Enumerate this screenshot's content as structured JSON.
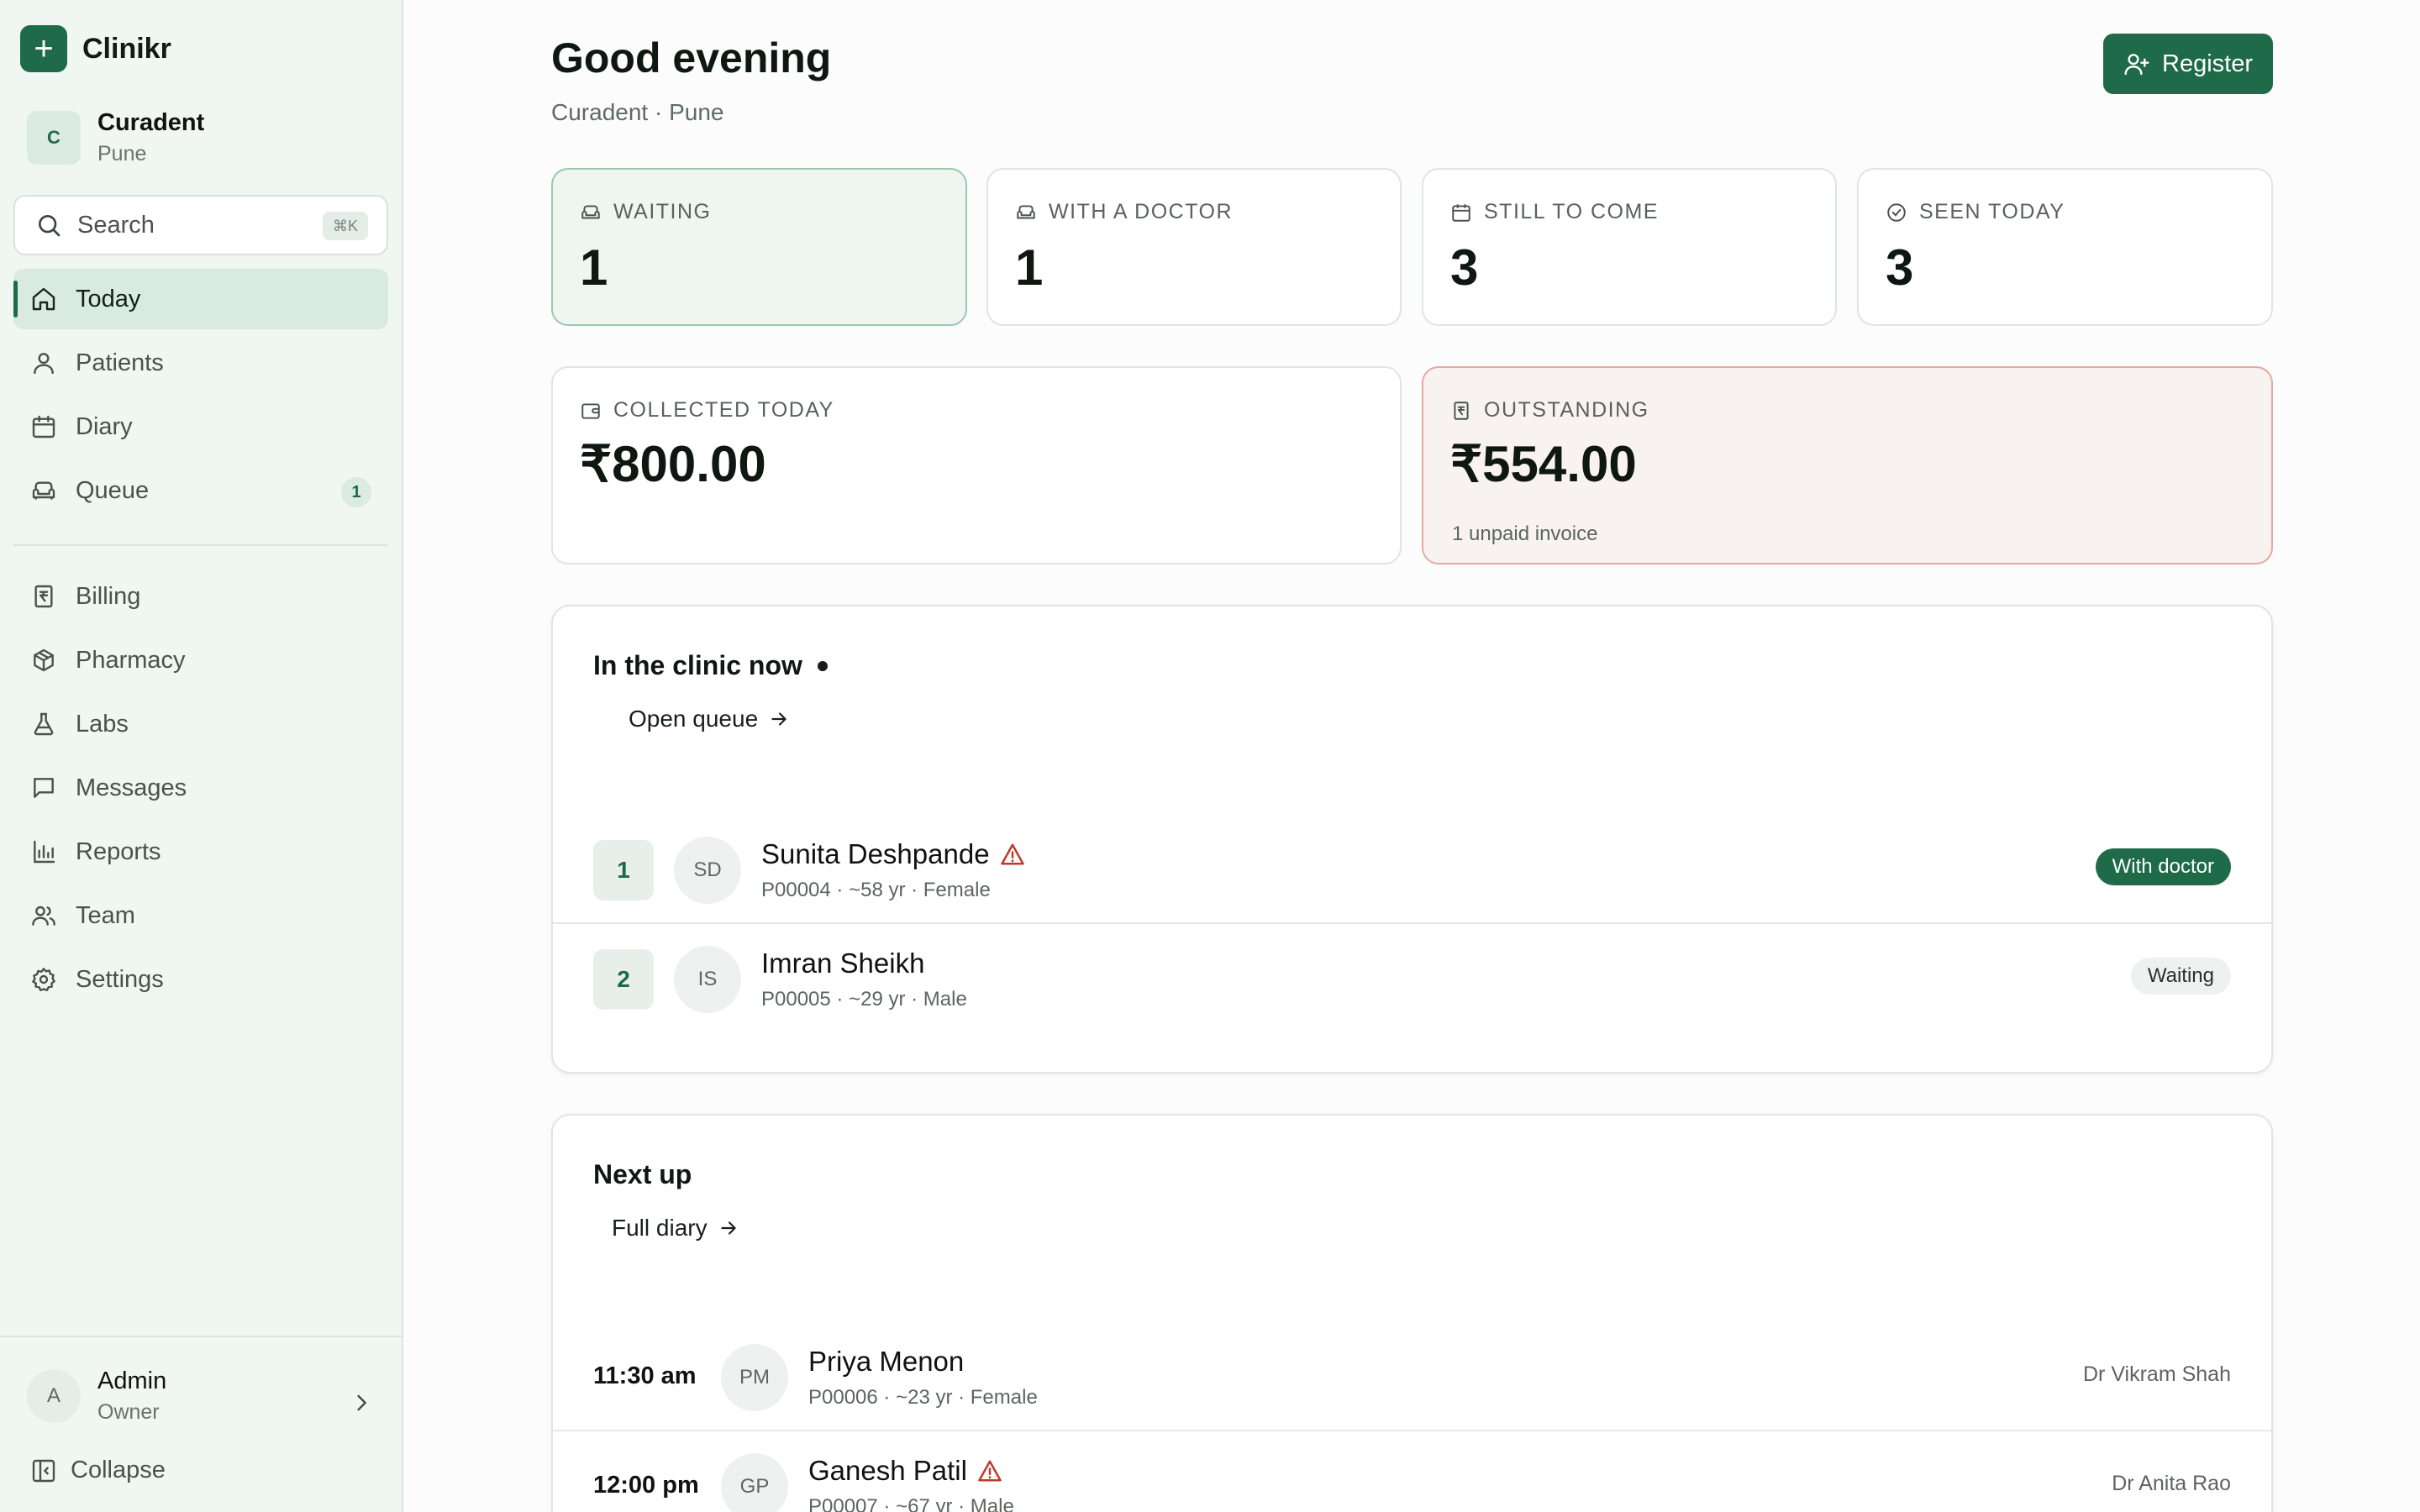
{
  "brand": {
    "logo_glyph": "+",
    "name": "Clinikr"
  },
  "org": {
    "initial": "C",
    "name": "Curadent",
    "city": "Pune"
  },
  "search": {
    "label": "Search",
    "shortcut": "⌘K"
  },
  "nav": {
    "primary": [
      {
        "label": "Today",
        "icon": "home-icon",
        "active": true
      },
      {
        "label": "Patients",
        "icon": "user-icon"
      },
      {
        "label": "Diary",
        "icon": "calendar-icon"
      },
      {
        "label": "Queue",
        "icon": "couch-icon",
        "badge": "1"
      }
    ],
    "secondary": [
      {
        "label": "Billing",
        "icon": "receipt-icon"
      },
      {
        "label": "Pharmacy",
        "icon": "package-icon"
      },
      {
        "label": "Labs",
        "icon": "flask-icon"
      },
      {
        "label": "Messages",
        "icon": "message-icon"
      },
      {
        "label": "Reports",
        "icon": "bar-chart-icon"
      },
      {
        "label": "Team",
        "icon": "users-icon"
      },
      {
        "label": "Settings",
        "icon": "gear-icon"
      }
    ]
  },
  "user": {
    "initial": "A",
    "name": "Admin",
    "role": "Owner"
  },
  "collapse_label": "Collapse",
  "header": {
    "greeting": "Good evening",
    "subline": "Curadent · Pune",
    "register_label": "Register"
  },
  "stats": {
    "waiting": {
      "label": "WAITING",
      "value": "1"
    },
    "with_doctor": {
      "label": "WITH A DOCTOR",
      "value": "1"
    },
    "still_to_come": {
      "label": "STILL TO COME",
      "value": "3"
    },
    "seen_today": {
      "label": "SEEN TODAY",
      "value": "3"
    },
    "collected": {
      "label": "COLLECTED TODAY",
      "value": "₹800.00"
    },
    "outstanding": {
      "label": "OUTSTANDING",
      "value": "₹554.00",
      "note": "1 unpaid invoice"
    }
  },
  "clinic_now": {
    "title": "In the clinic now",
    "link": "Open queue",
    "rows": [
      {
        "number": "1",
        "initials": "SD",
        "name": "Sunita Deshpande",
        "alert": true,
        "meta": "P00004 · ~58 yr · Female",
        "status": "With doctor"
      },
      {
        "number": "2",
        "initials": "IS",
        "name": "Imran Sheikh",
        "alert": false,
        "meta": "P00005 · ~29 yr · Male",
        "status": "Waiting"
      }
    ]
  },
  "next_up": {
    "title": "Next up",
    "link": "Full diary",
    "rows": [
      {
        "time": "11:30 am",
        "initials": "PM",
        "name": "Priya Menon",
        "alert": false,
        "meta": "P00006 · ~23 yr · Female",
        "doctor": "Dr Vikram Shah"
      },
      {
        "time": "12:00 pm",
        "initials": "GP",
        "name": "Ganesh Patil",
        "alert": true,
        "meta": "P00007 · ~67 yr · Male",
        "doctor": "Dr Anita Rao"
      }
    ]
  },
  "colors": {
    "brand": "#1f6a49",
    "warning": "#c0392b",
    "sidebar_bg": "#f0f6f2"
  }
}
